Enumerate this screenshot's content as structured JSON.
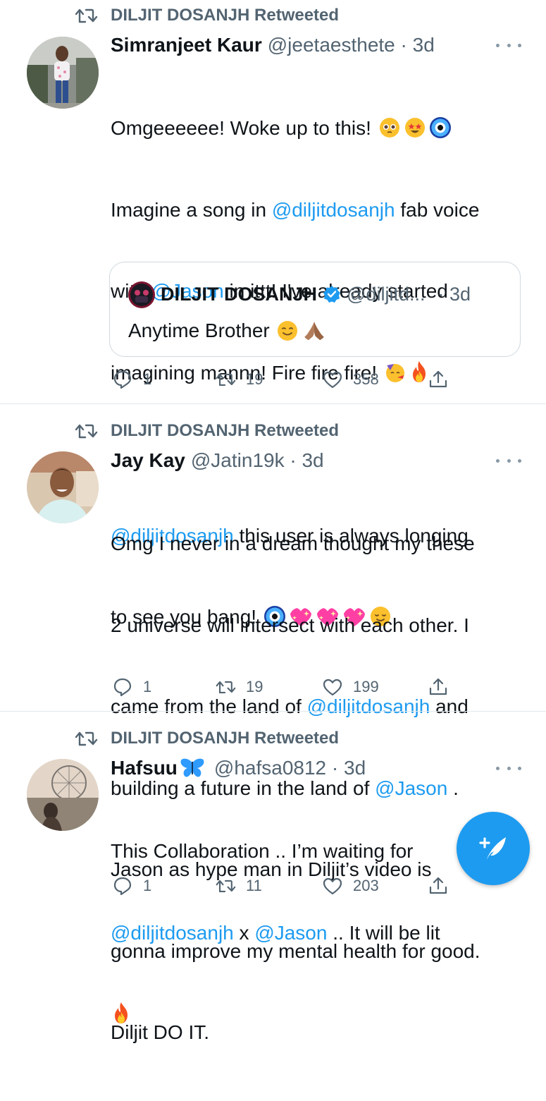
{
  "tweets": [
    {
      "retweeted_by": "DILJIT DOSANJH Retweeted",
      "name": "Simranjeet Kaur",
      "handle": "@jeetaesthete · 3d",
      "body": {
        "l1": "Omgeeeeee! Woke up to this!",
        "l2a": "Imagine a song in ",
        "l2m": "@diljitdosanjh",
        "l2b": " fab voice",
        "l3a": "with ",
        "l3m": "@Jason",
        "l3b": " in ittt! I've already started",
        "l4": "imagining mannn! Fire fire fire!",
        "l6m": "@diljitdosanjh",
        "l6b": " this user is always longing",
        "l7": "to see you bang!"
      },
      "quote": {
        "name": "DILJIT DOSANJH",
        "handle": "@diljitd...",
        "time": "· 3d",
        "text": "Anytime Brother"
      },
      "replies": "1",
      "retweets": "19",
      "likes": "358"
    },
    {
      "retweeted_by": "DILJIT DOSANJH Retweeted",
      "name": "Jay Kay",
      "handle": "@Jatin19k · 3d",
      "body": {
        "l1": "Omg I never in a dream thought my these",
        "l2": "2 universe will intersect with each other. I",
        "l3a": "came from the land of ",
        "l3m": "@diljitdosanjh",
        "l3b": " and",
        "l4a": "building a future in the land of ",
        "l4m": "@Jason",
        "l4b": " .",
        "l5": "Jason as hype man in Diljit’s video is",
        "l6": "gonna improve my mental health for good.",
        "l7": "Diljit DO IT."
      },
      "replies": "1",
      "retweets": "19",
      "likes": "199"
    },
    {
      "retweeted_by": "DILJIT DOSANJH Retweeted",
      "name": "Hafsuu",
      "handle": "@hafsa0812 · 3d",
      "body": {
        "l1": "This Collaboration .. I’m waiting for",
        "l2m1": "@diljitdosanjh",
        "l2b": " x ",
        "l2m2": "@Jason",
        "l2c": " .. It will be lit"
      },
      "replies": "1",
      "retweets": "11",
      "likes": "203"
    }
  ],
  "icons": {
    "retweet": "retweet-icon",
    "reply": "reply-icon",
    "like": "heart-icon",
    "share": "share-icon",
    "more": "more-icon",
    "compose": "compose-tweet-icon",
    "verified": "verified-badge-icon"
  },
  "colors": {
    "accent": "#1d9bf0",
    "secondary_text": "#536471",
    "divider": "#e1e8ed"
  }
}
